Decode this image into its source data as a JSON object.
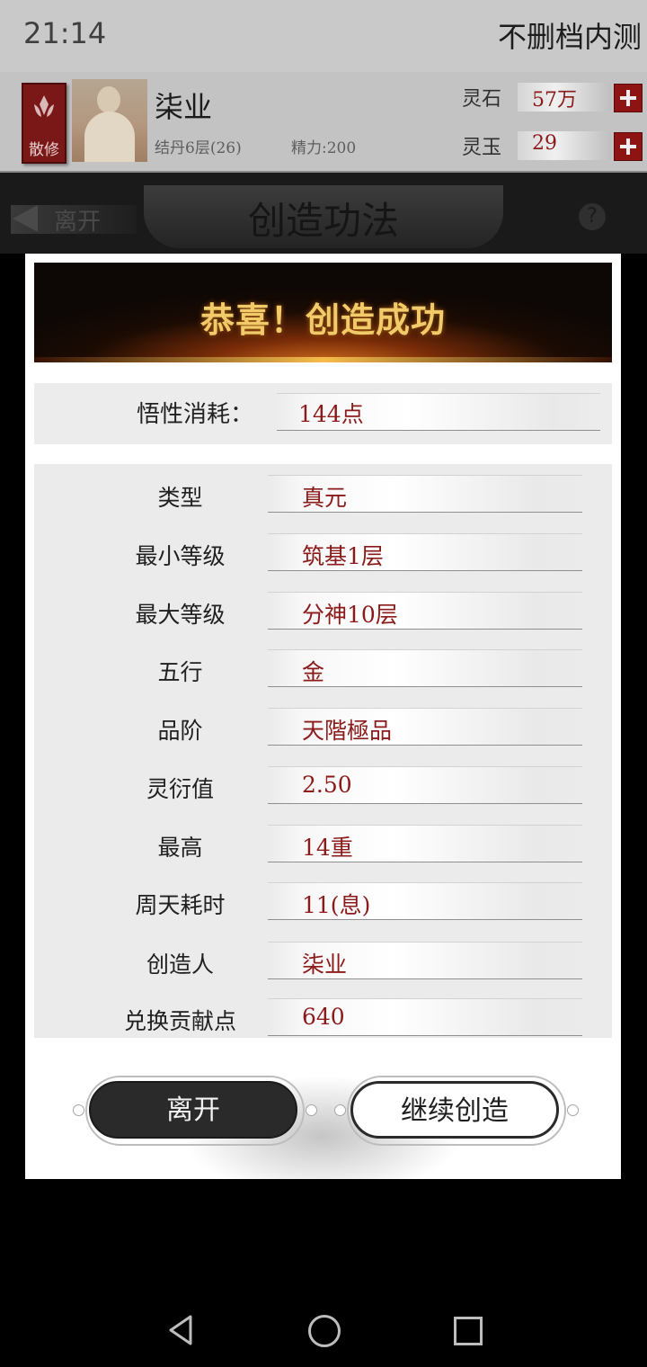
{
  "status_bar": {
    "time": "21:14"
  },
  "app": {
    "title": "不删档内测"
  },
  "player": {
    "sect_label": "散修",
    "name": "柒业",
    "realm": "结丹6层(26)",
    "stamina": "精力:200"
  },
  "currencies": [
    {
      "label": "灵石",
      "value": "57万"
    },
    {
      "label": "灵玉",
      "value": "29"
    }
  ],
  "header": {
    "back_label": "离开",
    "screen_title": "创造功法",
    "help_icon": "?"
  },
  "modal": {
    "title": "恭喜！创造成功",
    "cost": {
      "label": "悟性消耗：",
      "value": "144点"
    },
    "rows": [
      {
        "label": "类型",
        "value": "真元"
      },
      {
        "label": "最小等级",
        "value": "筑基1层"
      },
      {
        "label": "最大等级",
        "value": "分神10层"
      },
      {
        "label": "五行",
        "value": "金"
      },
      {
        "label": "品阶",
        "value": "天階極品"
      },
      {
        "label": "灵衍值",
        "value": "2.50"
      },
      {
        "label": "最高",
        "value": "14重"
      },
      {
        "label": "周天耗时",
        "value": "11(息)"
      },
      {
        "label": "创造人",
        "value": "柒业"
      },
      {
        "label": "兑换贡献点",
        "value": "640"
      }
    ],
    "buttons": {
      "leave": "离开",
      "continue": "继续创造"
    }
  },
  "colors": {
    "accent_red": "#8b1a1a",
    "banner_gold": "#f1cb6a",
    "dark_button": "#2a2a2a"
  },
  "icons": [
    "sect-emblem-icon",
    "plus-icon",
    "back-arrow-icon",
    "help-icon",
    "nav-back-icon",
    "nav-home-icon",
    "nav-recent-icon"
  ]
}
